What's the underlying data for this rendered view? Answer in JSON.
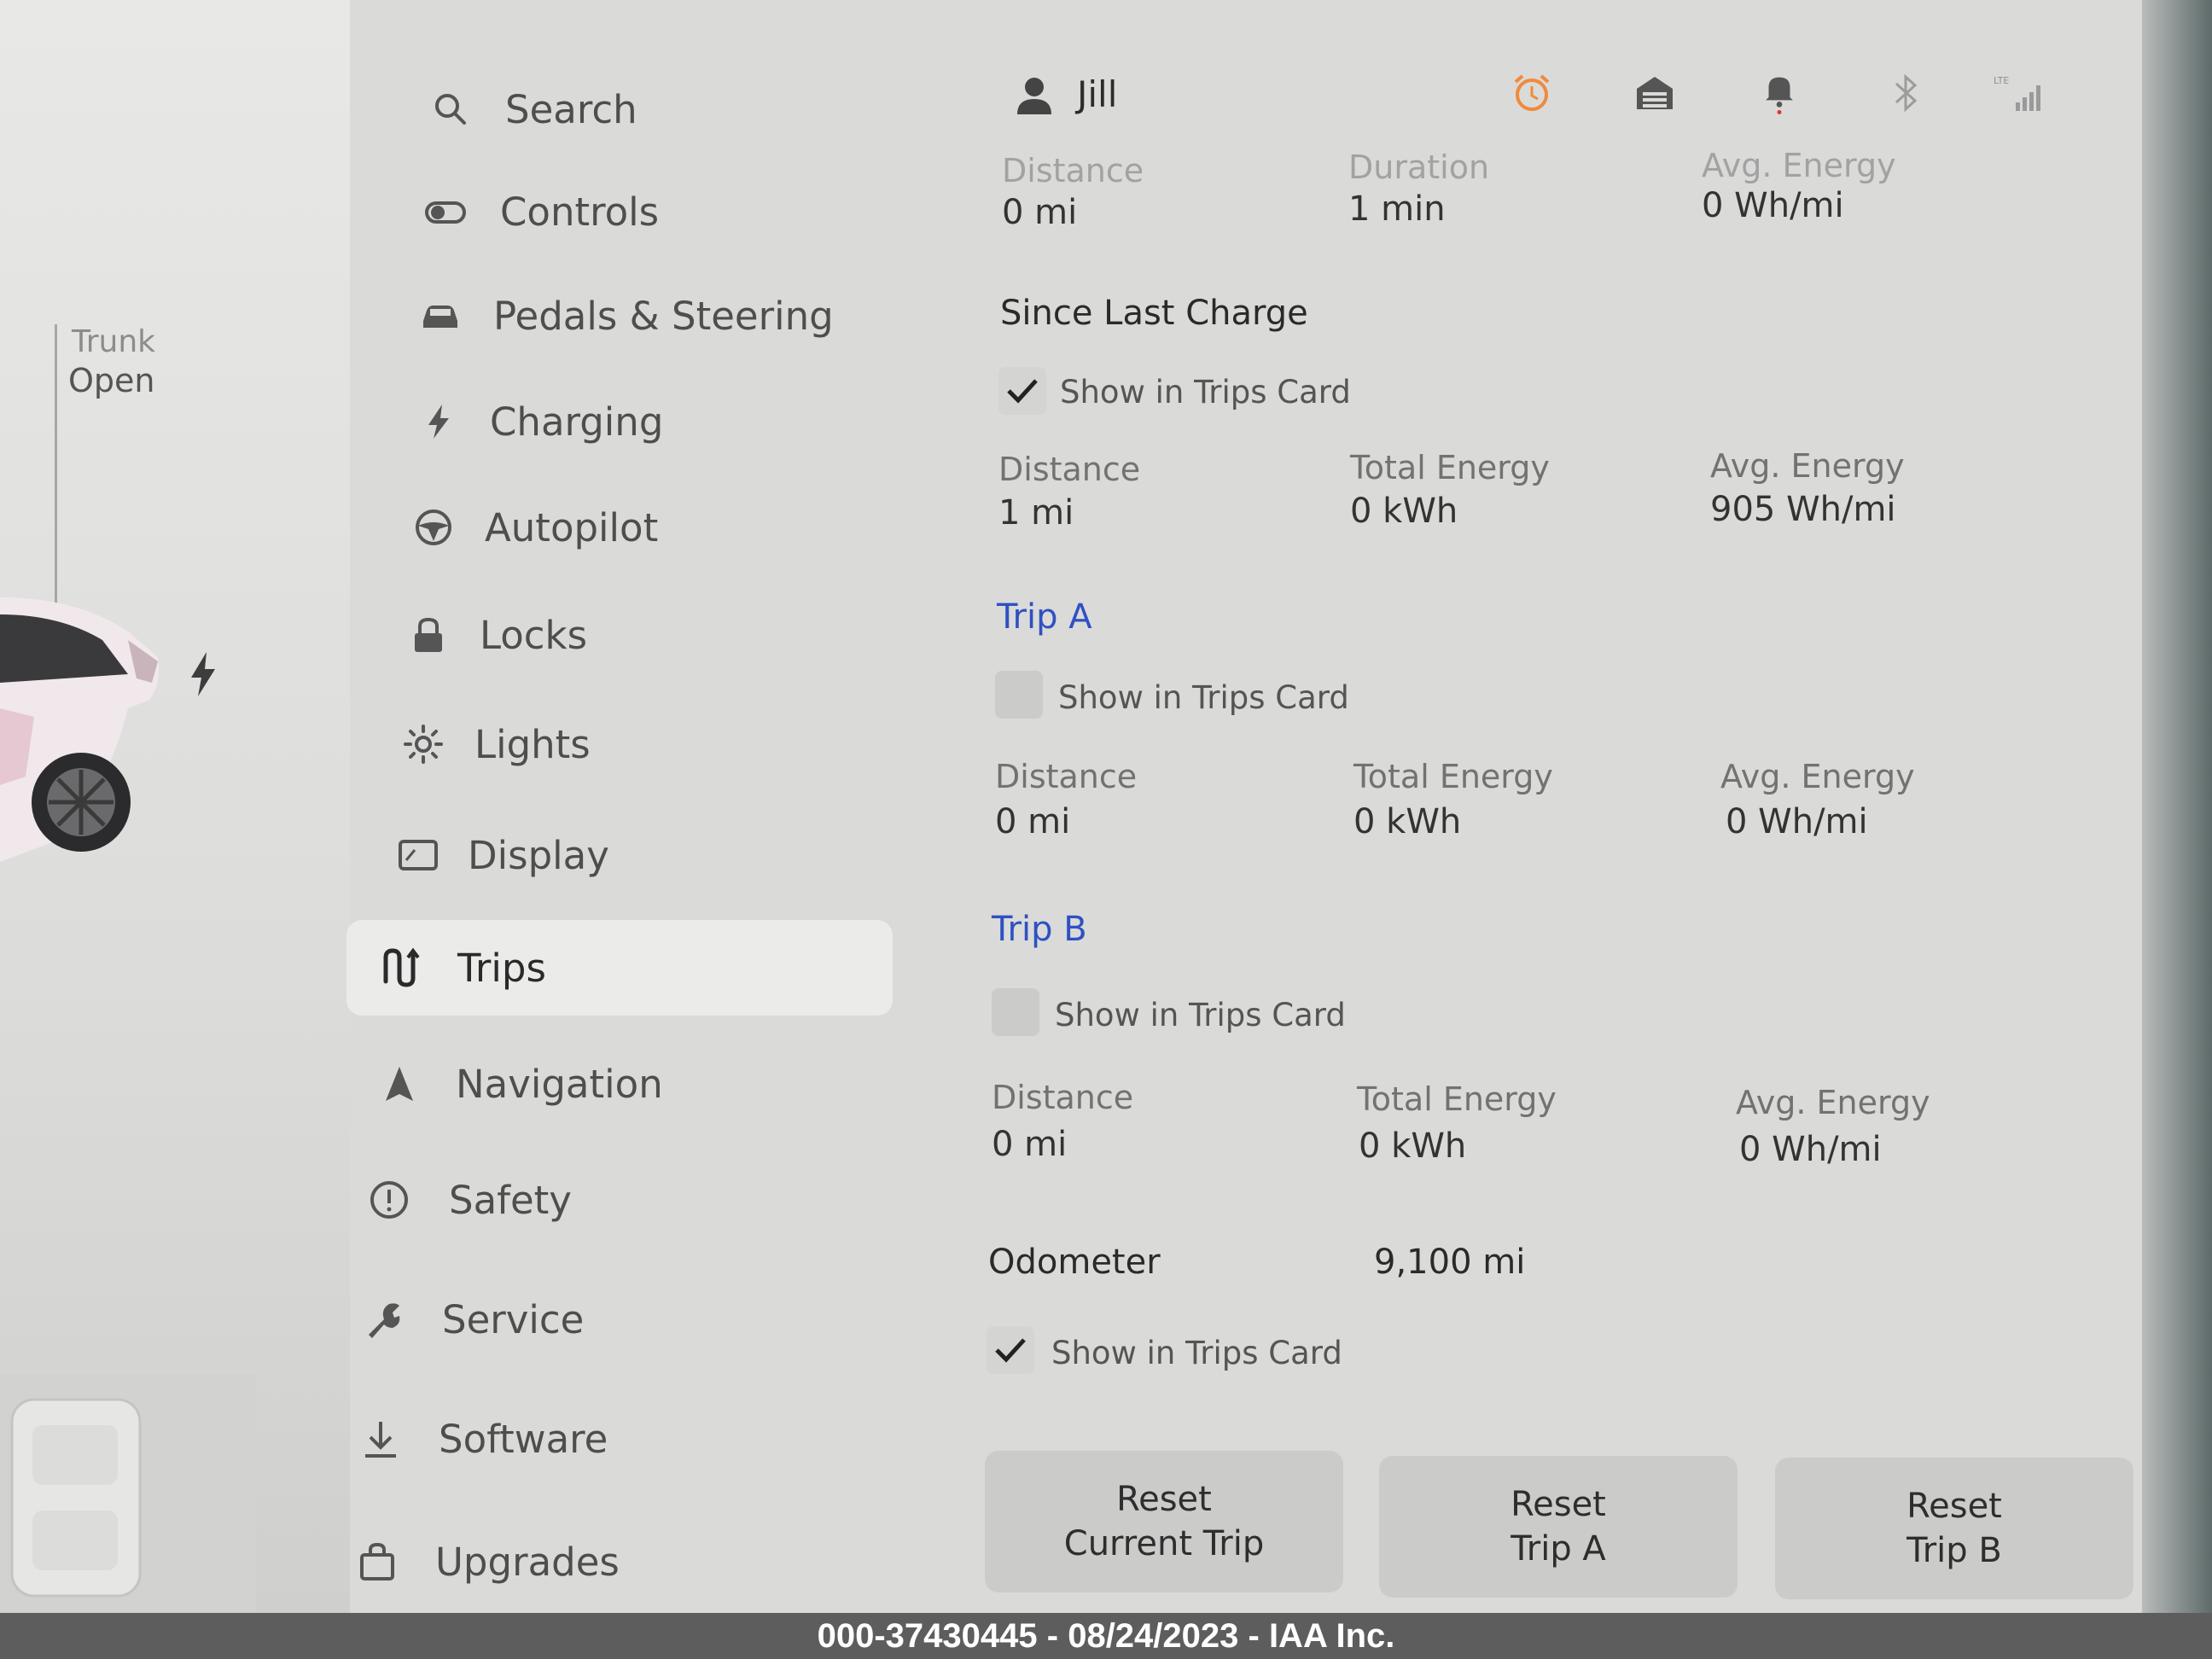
{
  "car_panel": {
    "trunk_title": "Trunk",
    "trunk_status": "Open"
  },
  "status_bar": {
    "user_name": "Jill",
    "icons": [
      "alarm-clock-icon",
      "homelink-garage-icon",
      "notification-bell-icon",
      "bluetooth-icon",
      "lte-signal-icon"
    ],
    "alarm_color": "#f08a3c",
    "notification_dot_color": "#e0323a"
  },
  "sidebar": {
    "items": [
      {
        "label": "Search",
        "icon": "search-icon"
      },
      {
        "label": "Controls",
        "icon": "toggle-icon"
      },
      {
        "label": "Pedals & Steering",
        "icon": "car-icon"
      },
      {
        "label": "Charging",
        "icon": "lightning-icon"
      },
      {
        "label": "Autopilot",
        "icon": "steering-wheel-icon"
      },
      {
        "label": "Locks",
        "icon": "lock-icon"
      },
      {
        "label": "Lights",
        "icon": "sun-icon"
      },
      {
        "label": "Display",
        "icon": "display-icon"
      },
      {
        "label": "Trips",
        "icon": "trips-route-icon",
        "active": true
      },
      {
        "label": "Navigation",
        "icon": "navigation-arrow-icon"
      },
      {
        "label": "Safety",
        "icon": "safety-alert-icon"
      },
      {
        "label": "Service",
        "icon": "wrench-icon"
      },
      {
        "label": "Software",
        "icon": "download-icon"
      },
      {
        "label": "Upgrades",
        "icon": "shopping-bag-icon"
      }
    ]
  },
  "current_trip": {
    "distance_label": "Distance",
    "distance_value": "0 mi",
    "duration_label": "Duration",
    "duration_value": "1 min",
    "avg_energy_label": "Avg. Energy",
    "avg_energy_value": "0 Wh/mi"
  },
  "since_last_charge": {
    "heading": "Since Last Charge",
    "show_in_trips_card": {
      "label": "Show in Trips Card",
      "checked": true
    },
    "distance_label": "Distance",
    "distance_value": "1 mi",
    "total_energy_label": "Total Energy",
    "total_energy_value": "0 kWh",
    "avg_energy_label": "Avg. Energy",
    "avg_energy_value": "905 Wh/mi"
  },
  "trip_a": {
    "heading": "Trip A",
    "show_in_trips_card": {
      "label": "Show in Trips Card",
      "checked": false
    },
    "distance_label": "Distance",
    "distance_value": "0 mi",
    "total_energy_label": "Total Energy",
    "total_energy_value": "0 kWh",
    "avg_energy_label": "Avg. Energy",
    "avg_energy_value": "0 Wh/mi"
  },
  "trip_b": {
    "heading": "Trip B",
    "show_in_trips_card": {
      "label": "Show in Trips Card",
      "checked": false
    },
    "distance_label": "Distance",
    "distance_value": "0 mi",
    "total_energy_label": "Total Energy",
    "total_energy_value": "0 kWh",
    "avg_energy_label": "Avg. Energy",
    "avg_energy_value": "0 Wh/mi"
  },
  "odometer": {
    "label": "Odometer",
    "value": "9,100 mi",
    "show_in_trips_card": {
      "label": "Show in Trips Card",
      "checked": true
    }
  },
  "buttons": {
    "reset_current_line1": "Reset",
    "reset_current_line2": "Current Trip",
    "reset_a_line1": "Reset",
    "reset_a_line2": "Trip A",
    "reset_b_line1": "Reset",
    "reset_b_line2": "Trip B"
  },
  "footer": {
    "text": "000-37430445 - 08/24/2023 - IAA Inc."
  },
  "colors": {
    "accent_blue": "#2f50c4",
    "panel_bg": "#dadad8",
    "active_item_bg": "#ebebea"
  }
}
